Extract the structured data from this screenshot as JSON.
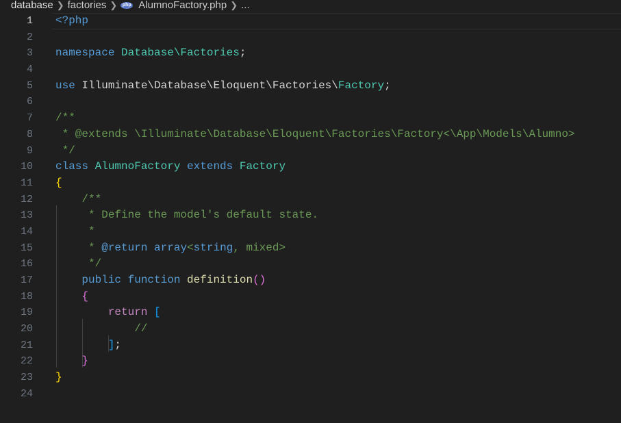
{
  "breadcrumb": {
    "segments": [
      "database",
      "factories"
    ],
    "file_icon_label": "php",
    "file_name": "AlumnoFactory.php",
    "ellipsis": "..."
  },
  "editor": {
    "lines": [
      {
        "n": "1",
        "tokens": [
          {
            "t": "<?php",
            "c": "phpkw"
          }
        ]
      },
      {
        "n": "2",
        "tokens": []
      },
      {
        "n": "3",
        "tokens": [
          {
            "t": "namespace ",
            "c": "kw-blue"
          },
          {
            "t": "Database\\Factories",
            "c": "ns"
          },
          {
            "t": ";",
            "c": "plain"
          }
        ]
      },
      {
        "n": "4",
        "tokens": []
      },
      {
        "n": "5",
        "tokens": [
          {
            "t": "use ",
            "c": "kw-blue"
          },
          {
            "t": "Illuminate\\Database\\Eloquent\\Factories\\",
            "c": "plain"
          },
          {
            "t": "Factory",
            "c": "cls"
          },
          {
            "t": ";",
            "c": "plain"
          }
        ]
      },
      {
        "n": "6",
        "tokens": []
      },
      {
        "n": "7",
        "tokens": [
          {
            "t": "/**",
            "c": "cm"
          }
        ]
      },
      {
        "n": "8",
        "tokens": [
          {
            "t": " * @extends \\Illuminate\\Database\\Eloquent\\Factories\\Factory<\\App\\Models\\Alumno>",
            "c": "cm"
          }
        ]
      },
      {
        "n": "9",
        "tokens": [
          {
            "t": " */",
            "c": "cm"
          }
        ]
      },
      {
        "n": "10",
        "tokens": [
          {
            "t": "class ",
            "c": "kw-blue"
          },
          {
            "t": "AlumnoFactory ",
            "c": "cls"
          },
          {
            "t": "extends ",
            "c": "kw-blue"
          },
          {
            "t": "Factory",
            "c": "cls"
          }
        ]
      },
      {
        "n": "11",
        "tokens": [
          {
            "t": "{",
            "c": "brace-y"
          }
        ]
      },
      {
        "n": "12",
        "tokens": [
          {
            "t": "    ",
            "c": "plain"
          },
          {
            "t": "/**",
            "c": "cm"
          }
        ]
      },
      {
        "n": "13",
        "tokens": [
          {
            "t": "     * Define the model's default state.",
            "c": "cm"
          }
        ]
      },
      {
        "n": "14",
        "tokens": [
          {
            "t": "     *",
            "c": "cm"
          }
        ]
      },
      {
        "n": "15",
        "tokens": [
          {
            "t": "     * ",
            "c": "cm"
          },
          {
            "t": "@return ",
            "c": "cm-tag"
          },
          {
            "t": "array",
            "c": "cm-tag"
          },
          {
            "t": "<",
            "c": "cm"
          },
          {
            "t": "string",
            "c": "cm-tag"
          },
          {
            "t": ", ",
            "c": "cm"
          },
          {
            "t": "mixed",
            "c": "cm"
          },
          {
            "t": ">",
            "c": "cm"
          }
        ]
      },
      {
        "n": "16",
        "tokens": [
          {
            "t": "     */",
            "c": "cm"
          }
        ]
      },
      {
        "n": "17",
        "tokens": [
          {
            "t": "    ",
            "c": "plain"
          },
          {
            "t": "public ",
            "c": "kw-blue"
          },
          {
            "t": "function ",
            "c": "kw-blue"
          },
          {
            "t": "definition",
            "c": "fn"
          },
          {
            "t": "()",
            "c": "brace-p"
          }
        ]
      },
      {
        "n": "18",
        "tokens": [
          {
            "t": "    ",
            "c": "plain"
          },
          {
            "t": "{",
            "c": "brace-p"
          }
        ]
      },
      {
        "n": "19",
        "tokens": [
          {
            "t": "        ",
            "c": "plain"
          },
          {
            "t": "return ",
            "c": "kw-purple"
          },
          {
            "t": "[",
            "c": "brace-b"
          }
        ]
      },
      {
        "n": "20",
        "tokens": [
          {
            "t": "            ",
            "c": "plain"
          },
          {
            "t": "//",
            "c": "cm"
          }
        ]
      },
      {
        "n": "21",
        "tokens": [
          {
            "t": "        ",
            "c": "plain"
          },
          {
            "t": "]",
            "c": "brace-b"
          },
          {
            "t": ";",
            "c": "plain"
          }
        ]
      },
      {
        "n": "22",
        "tokens": [
          {
            "t": "    ",
            "c": "plain"
          },
          {
            "t": "}",
            "c": "brace-p"
          }
        ]
      },
      {
        "n": "23",
        "tokens": [
          {
            "t": "}",
            "c": "brace-y"
          }
        ]
      },
      {
        "n": "24",
        "tokens": []
      }
    ],
    "current_line": "1"
  },
  "colors": {
    "background": "#1f1f1f",
    "keyword": "#569cd6",
    "control": "#c586c0",
    "type": "#4ec9b0",
    "function": "#dcdcaa",
    "comment": "#6a9955"
  }
}
